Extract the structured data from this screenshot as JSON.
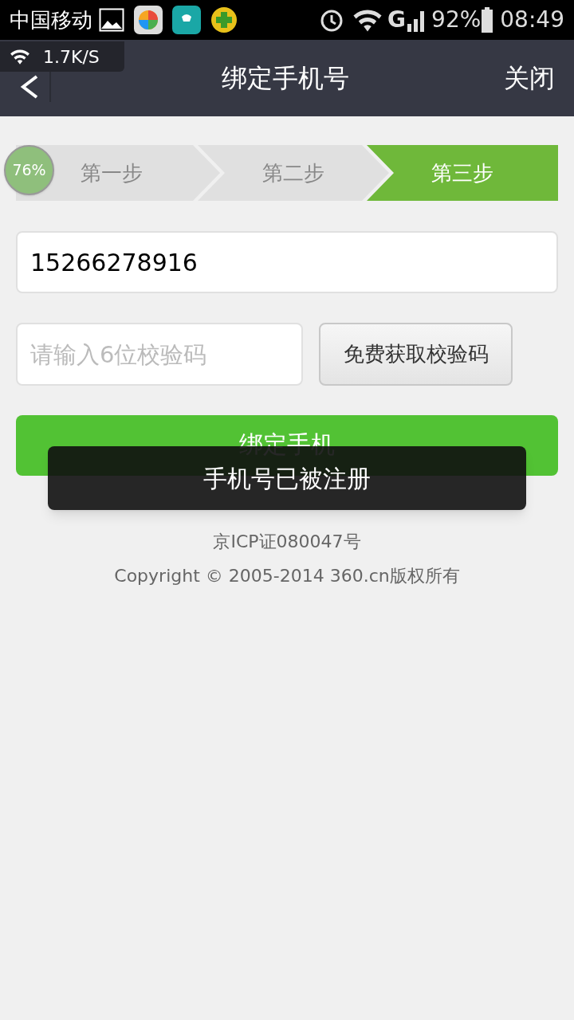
{
  "status_bar": {
    "carrier": "中国移动",
    "network": "G",
    "battery": "92%",
    "time": "08:49"
  },
  "speed_widget": {
    "speed": "1.7K/S"
  },
  "nav_bar": {
    "title": "绑定手机号",
    "close": "关闭"
  },
  "floating_ball": {
    "percent": "76%"
  },
  "steps": [
    {
      "label": "第一步",
      "selected": false
    },
    {
      "label": "第二步",
      "selected": false
    },
    {
      "label": "第三步",
      "selected": true
    }
  ],
  "phone_field": {
    "value": "15266278916"
  },
  "code_field": {
    "placeholder": "请输入6位校验码"
  },
  "get_code_button": "免费获取校验码",
  "bind_button": "绑定手机",
  "toast": "手机号已被注册",
  "footer": {
    "icp": "京ICP证080047号",
    "copyright": "Copyright © 2005-2014 360.cn版权所有"
  }
}
